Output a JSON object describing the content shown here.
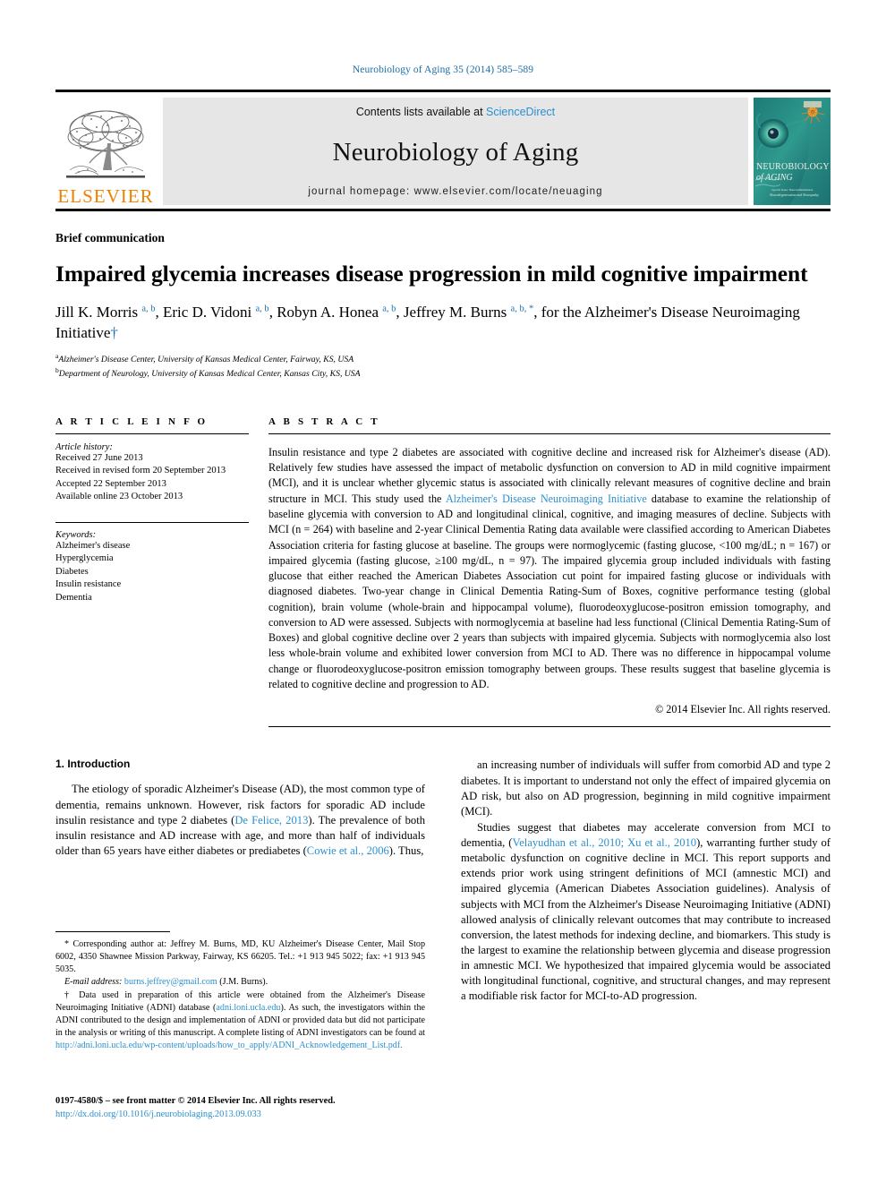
{
  "running_head": "Neurobiology of Aging 35 (2014) 585–589",
  "masthead": {
    "elsevier_wordmark": "ELSEVIER",
    "contents_prefix": "Contents lists available at ",
    "sciencedirect": "ScienceDirect",
    "journal_title": "Neurobiology of Aging",
    "homepage": "journal homepage: www.elsevier.com/locate/neuaging",
    "cover_title_line1": "NEUROBIOLOGY",
    "cover_title_line2": "of AGING",
    "cover_subtitle": "Special Issue: Neuroinflammation and Neuropathy"
  },
  "article": {
    "type_label": "Brief communication",
    "title": "Impaired glycemia increases disease progression in mild cognitive impairment",
    "authors_html": "Jill K. Morris <sup>a, b</sup>, Eric D. Vidoni <sup>a, b</sup>, Robyn A. Honea <sup>a, b</sup>, Jeffrey M. Burns <sup>a, b, *</sup>, for the Alzheimer's Disease Neuroimaging Initiative<span class=\"dagger\">†</span>",
    "affiliation_a": "Alzheimer's Disease Center, University of Kansas Medical Center, Fairway, KS, USA",
    "affiliation_b": "Department of Neurology, University of Kansas Medical Center, Kansas City, KS, USA",
    "affiliation_a_marker": "a",
    "affiliation_b_marker": "b"
  },
  "article_info": {
    "heading": "A R T I C L E  I N F O",
    "history_label": "Article history:",
    "history": [
      "Received 27 June 2013",
      "Received in revised form 20 September 2013",
      "Accepted 22 September 2013",
      "Available online 23 October 2013"
    ],
    "keywords_label": "Keywords:",
    "keywords": [
      "Alzheimer's disease",
      "Hyperglycemia",
      "Diabetes",
      "Insulin resistance",
      "Dementia"
    ]
  },
  "abstract": {
    "heading": "A B S T R A C T",
    "part1": "Insulin resistance and type 2 diabetes are associated with cognitive decline and increased risk for Alzheimer's disease (AD). Relatively few studies have assessed the impact of metabolic dysfunction on conversion to AD in mild cognitive impairment (MCI), and it is unclear whether glycemic status is associated with clinically relevant measures of cognitive decline and brain structure in MCI. This study used the ",
    "link_text": "Alzheimer's Disease Neuroimaging Initiative",
    "part2": " database to examine the relationship of baseline glycemia with conversion to AD and longitudinal clinical, cognitive, and imaging measures of decline. Subjects with MCI (n = 264) with baseline and 2-year Clinical Dementia Rating data available were classified according to American Diabetes Association criteria for fasting glucose at baseline. The groups were normoglycemic (fasting glucose, <100 mg/dL; n = 167) or impaired glycemia (fasting glucose, ≥100 mg/dL, n = 97). The impaired glycemia group included individuals with fasting glucose that either reached the American Diabetes Association cut point for impaired fasting glucose or individuals with diagnosed diabetes. Two-year change in Clinical Dementia Rating-Sum of Boxes, cognitive performance testing (global cognition), brain volume (whole-brain and hippocampal volume), fluorodeoxyglucose-positron emission tomography, and conversion to AD were assessed. Subjects with normoglycemia at baseline had less functional (Clinical Dementia Rating-Sum of Boxes) and global cognitive decline over 2 years than subjects with impaired glycemia. Subjects with normoglycemia also lost less whole-brain volume and exhibited lower conversion from MCI to AD. There was no difference in hippocampal volume change or fluorodeoxyglucose-positron emission tomography between groups. These results suggest that baseline glycemia is related to cognitive decline and progression to AD.",
    "copyright": "© 2014 Elsevier Inc. All rights reserved."
  },
  "introduction": {
    "heading": "1. Introduction",
    "left_para_part1": "The etiology of sporadic Alzheimer's Disease (AD), the most common type of dementia, remains unknown. However, risk factors for sporadic AD include insulin resistance and type 2 diabetes (",
    "left_cite1": "De Felice, 2013",
    "left_para_part2": "). The prevalence of both insulin resistance and AD increase with age, and more than half of individuals older than 65 years have either diabetes or prediabetes (",
    "left_cite2": "Cowie et al., 2006",
    "left_para_part3": "). Thus,",
    "right_para1": "an increasing number of individuals will suffer from comorbid AD and type 2 diabetes. It is important to understand not only the effect of impaired glycemia on AD risk, but also on AD progression, beginning in mild cognitive impairment (MCI).",
    "right_para2_part1": "Studies suggest that diabetes may accelerate conversion from MCI to dementia, (",
    "right_cite1": "Velayudhan et al., 2010; Xu et al., 2010",
    "right_para2_part2": "), warranting further study of metabolic dysfunction on cognitive decline in MCI. This report supports and extends prior work using stringent definitions of MCI (amnestic MCI) and impaired glycemia (American Diabetes Association guidelines). Analysis of subjects with MCI from the Alzheimer's Disease Neuroimaging Initiative (ADNI) allowed analysis of clinically relevant outcomes that may contribute to increased conversion, the latest methods for indexing decline, and biomarkers. This study is the largest to examine the relationship between glycemia and disease progression in amnestic MCI. We hypothesized that impaired glycemia would be associated with longitudinal functional, cognitive, and structural changes, and may represent a modifiable risk factor for MCI-to-AD progression."
  },
  "footnotes": {
    "corresponding_marker": "*",
    "corresponding_text": "Corresponding author at: Jeffrey M. Burns, MD, KU Alzheimer's Disease Center, Mail Stop 6002, 4350 Shawnee Mission Parkway, Fairway, KS 66205. Tel.: +1 913 945 5022; fax: +1 913 945 5035.",
    "email_label": "E-mail address:",
    "email": "burns.jeffrey@gmail.com",
    "email_suffix": " (J.M. Burns).",
    "dagger_marker": "†",
    "dagger_part1": "Data used in preparation of this article were obtained from the Alzheimer's Disease Neuroimaging Initiative (ADNI) database (",
    "dagger_link1": "adni.loni.ucla.edu",
    "dagger_part2": "). As such, the investigators within the ADNI contributed to the design and implementation of ADNI or provided data but did not participate in the analysis or writing of this manuscript. A complete listing of ADNI investigators can be found at ",
    "dagger_link2": "http://adni.loni.ucla.edu/wp-content/uploads/how_to_apply/ADNI_Acknowledgement_List.pdf."
  },
  "imprint": {
    "issn_line": "0197-4580/$ – see front matter © 2014 Elsevier Inc. All rights reserved.",
    "doi": "http://dx.doi.org/10.1016/j.neurobiolaging.2013.09.033"
  },
  "colors": {
    "link_blue": "#2a8fd0",
    "running_head_blue": "#1a6ea8",
    "elsevier_orange": "#F08000",
    "masthead_gray": "#e6e6e6"
  }
}
